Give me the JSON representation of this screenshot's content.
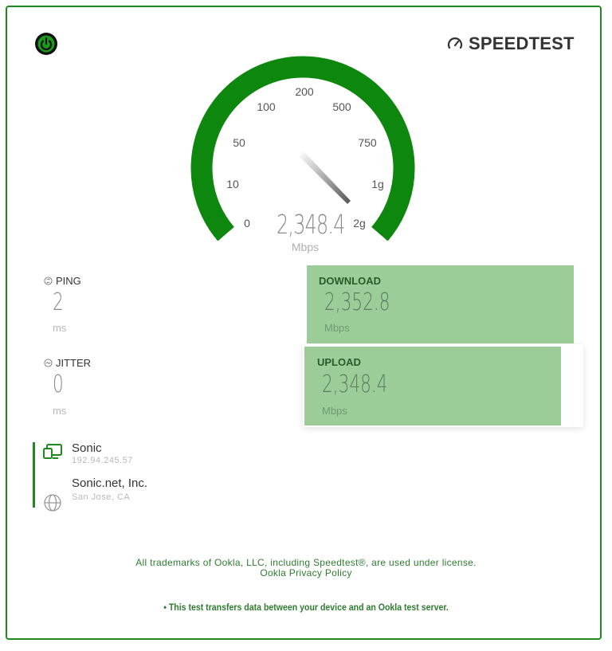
{
  "brand": {
    "name": "SPEEDTEST"
  },
  "gauge": {
    "ticks": [
      "0",
      "10",
      "50",
      "100",
      "200",
      "500",
      "750",
      "1g",
      "2g"
    ],
    "value": "2,348.4",
    "unit": "Mbps",
    "color": "#0e870e",
    "progress_fraction": 1.0
  },
  "ping": {
    "label": "PING",
    "value": "2",
    "unit": "ms"
  },
  "jitter": {
    "label": "JITTER",
    "value": "0",
    "unit": "ms"
  },
  "download": {
    "label": "DOWNLOAD",
    "value": "2,352.8",
    "unit": "Mbps"
  },
  "upload": {
    "label": "UPLOAD",
    "value": "2,348.4",
    "unit": "Mbps"
  },
  "isp": {
    "name": "Sonic",
    "ip": "192.94.245.57"
  },
  "server": {
    "name": "Sonic.net, Inc.",
    "location": "San Jose, CA"
  },
  "footer": {
    "trademark": "All trademarks of Ookla, LLC, including Speedtest®, are used under license.",
    "privacy_link": "Ookla Privacy Policy",
    "note": "• This test transfers data between your device and an Ookla test server."
  },
  "colors": {
    "accent": "#1f8a1f",
    "panel": "#9ccd98"
  }
}
